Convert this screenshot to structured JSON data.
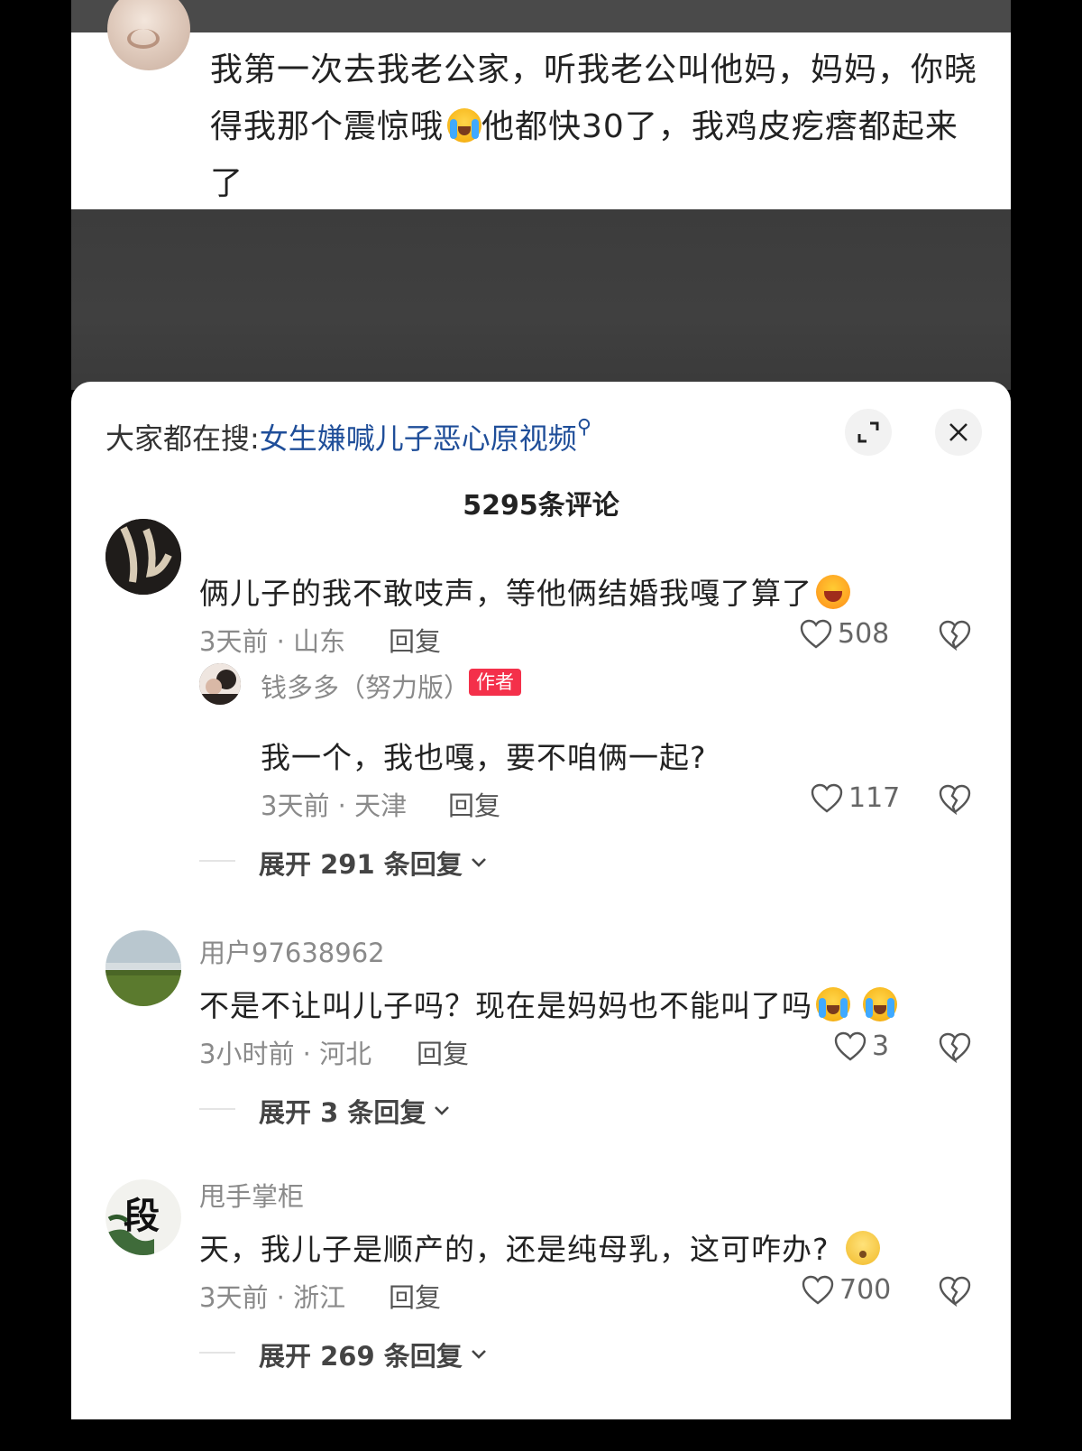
{
  "caption": {
    "text": "我第一次去我老公家，听我老公叫他妈，妈妈，你晓得我那个震惊哦",
    "emoji": "crying-laughing",
    "text_after": "他都快30了，我鸡皮疙瘩都起来了"
  },
  "panel": {
    "search_prefix": "大家都在搜:",
    "search_query": "女生嫌喊儿子恶心原视频",
    "search_icon": "search-icon",
    "expand_icon": "expand-icon",
    "close_icon": "close-icon",
    "comment_count": "5295条评论"
  },
  "comments": [
    {
      "text": "俩儿子的我不敢吱声，等他俩结婚我嘎了算了",
      "emoji": "laughing",
      "time_location": "3天前 · 山东",
      "reply_label": "回复",
      "likes": "508",
      "reply": {
        "user": "钱多多（努力版）",
        "badge": "作者",
        "text": "我一个，我也嘎，要不咱俩一起?",
        "time_location": "3天前 · 天津",
        "reply_label": "回复",
        "likes": "117"
      },
      "expand_label": "展开 291 条回复"
    },
    {
      "user": "用户97638962",
      "text": "不是不让叫儿子吗？现在是妈妈也不能叫了吗",
      "emoji": "crying-laughing x2",
      "time_location": "3小时前 · 河北",
      "reply_label": "回复",
      "likes": "3",
      "expand_label": "展开 3 条回复"
    },
    {
      "user": "甩手掌柜",
      "avatar_text": "段",
      "text": "天，我儿子是顺产的，还是纯母乳，这可咋办?",
      "emoji": "thinking",
      "time_location": "3天前 · 浙江",
      "reply_label": "回复",
      "likes": "700",
      "expand_label": "展开 269 条回复"
    }
  ]
}
